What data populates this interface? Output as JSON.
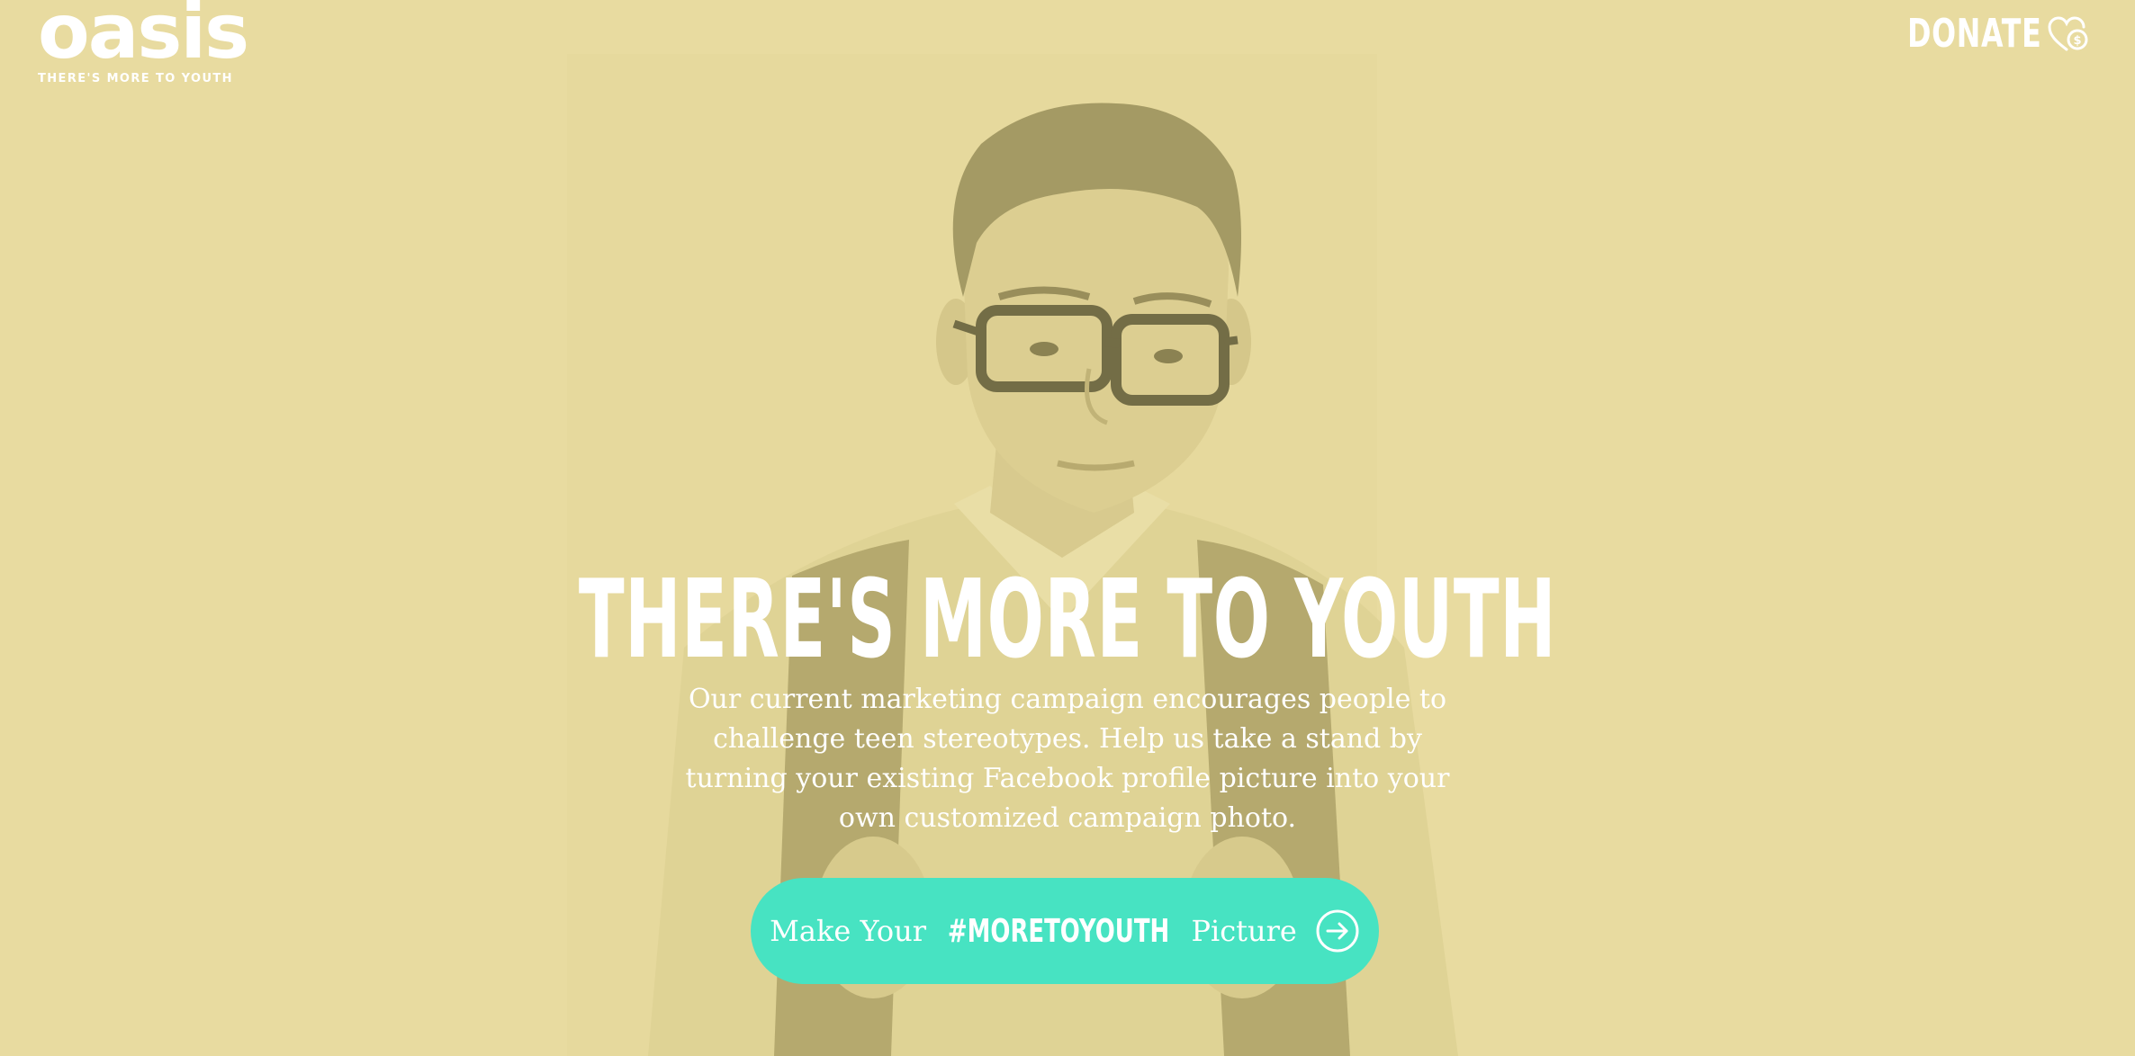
{
  "brand": {
    "name": "oasis",
    "tagline": "THERE'S MORE TO YOUTH"
  },
  "header": {
    "donate_label": "DONATE",
    "donate_icon": "heart-dollar-icon"
  },
  "hero": {
    "title": "THERE'S MORE TO YOUTH",
    "description": "Our current marketing campaign encourages people to challenge teen stereotypes. Help us take a stand by turning your existing Facebook profile picture into your own customized campaign photo."
  },
  "cta": {
    "prefix": "Make Your",
    "hashtag": "#MORETOYOUTH",
    "suffix": "Picture",
    "icon": "arrow-right-circle-icon"
  },
  "colors": {
    "background": "#e8dba0",
    "accent": "#47e3c2",
    "text": "#ffffff"
  }
}
